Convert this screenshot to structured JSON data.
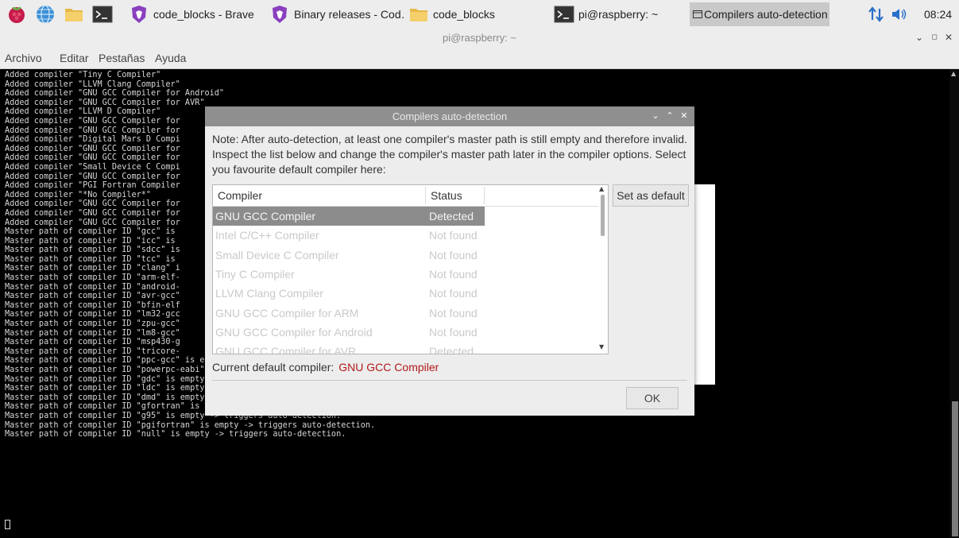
{
  "taskbar": {
    "launchers": [
      {
        "name": "raspberry-menu-icon"
      },
      {
        "name": "web-browser-icon"
      },
      {
        "name": "file-manager-icon"
      },
      {
        "name": "terminal-icon"
      }
    ],
    "windows": [
      {
        "label": "code_blocks - Brave",
        "icon": "brave-icon",
        "active": false
      },
      {
        "label": "Binary releases - Cod…",
        "icon": "brave-icon",
        "active": false
      },
      {
        "label": "code_blocks",
        "icon": "folder-icon",
        "active": false
      },
      {
        "label": "pi@raspberry: ~",
        "icon": "terminal-icon",
        "active": false
      },
      {
        "label": "Compilers auto-detection",
        "icon": "window-icon",
        "active": true
      }
    ],
    "clock": "08:24"
  },
  "window": {
    "title": "pi@raspberry: ~"
  },
  "menubar": {
    "items": [
      "Archivo",
      "Editar",
      "Pestañas",
      "Ayuda"
    ]
  },
  "terminal": {
    "lines": [
      "Added compiler \"Tiny C Compiler\"",
      "Added compiler \"LLVM Clang Compiler\"",
      "Added compiler \"GNU GCC Compiler for Android\"",
      "Added compiler \"GNU GCC Compiler for AVR\"",
      "Added compiler \"LLVM D Compiler\"",
      "Added compiler \"GNU GCC Compiler for",
      "Added compiler \"GNU GCC Compiler for",
      "Added compiler \"Digital Mars D Compi",
      "Added compiler \"GNU GCC Compiler for",
      "Added compiler \"GNU GCC Compiler for",
      "Added compiler \"Small Device C Compi",
      "Added compiler \"GNU GCC Compiler for",
      "Added compiler \"PGI Fortran Compiler",
      "Added compiler \"*No Compiler*\"",
      "Added compiler \"GNU GCC Compiler for",
      "Added compiler \"GNU GCC Compiler for",
      "Added compiler \"GNU GCC Compiler for",
      "Master path of compiler ID \"gcc\" is",
      "Master path of compiler ID \"icc\" is",
      "Master path of compiler ID \"sdcc\" is",
      "Master path of compiler ID \"tcc\" is",
      "Master path of compiler ID \"clang\" i",
      "Master path of compiler ID \"arm-elf-",
      "Master path of compiler ID \"android-",
      "Master path of compiler ID \"avr-gcc\"",
      "Master path of compiler ID \"bfin-elf",
      "Master path of compiler ID \"lm32-gcc",
      "Master path of compiler ID \"zpu-gcc\"",
      "Master path of compiler ID \"lm8-gcc\"",
      "Master path of compiler ID \"msp430-g",
      "Master path of compiler ID \"tricore-",
      "Master path of compiler ID \"ppc-gcc\" is empty -> triggers auto-detection.",
      "Master path of compiler ID \"powerpc-eabi\" is empty -> triggers auto-detection.",
      "Master path of compiler ID \"gdc\" is empty -> triggers auto-detection.",
      "Master path of compiler ID \"ldc\" is empty -> triggers auto-detection.",
      "Master path of compiler ID \"dmd\" is empty -> triggers auto-detection.",
      "Master path of compiler ID \"gfortran\" is empty -> triggers auto-detection.",
      "Master path of compiler ID \"g95\" is empty -> triggers auto-detection.",
      "Master path of compiler ID \"pgifortran\" is empty -> triggers auto-detection.",
      "Master path of compiler ID \"null\" is empty -> triggers auto-detection."
    ]
  },
  "dialog": {
    "title": "Compilers auto-detection",
    "note": "Note: After auto-detection, at least one compiler's master path is still empty and therefore invalid. Inspect the list below and change the compiler's master path later in the compiler options. Select you favourite default compiler here:",
    "columns": [
      "Compiler",
      "Status"
    ],
    "rows": [
      {
        "compiler": "GNU GCC Compiler",
        "status": "Detected",
        "selected": true
      },
      {
        "compiler": "Intel C/C++ Compiler",
        "status": "Not found",
        "selected": false
      },
      {
        "compiler": "Small Device C Compiler",
        "status": "Not found",
        "selected": false
      },
      {
        "compiler": "Tiny C Compiler",
        "status": "Not found",
        "selected": false
      },
      {
        "compiler": "LLVM Clang Compiler",
        "status": "Not found",
        "selected": false
      },
      {
        "compiler": "GNU GCC Compiler for ARM",
        "status": "Not found",
        "selected": false
      },
      {
        "compiler": "GNU GCC Compiler for Android",
        "status": "Not found",
        "selected": false
      },
      {
        "compiler": "GNU GCC Compiler for AVR",
        "status": "Detected",
        "selected": false
      }
    ],
    "set_default_label": "Set as default",
    "current_default_label": "Current default compiler:",
    "current_default_value": "GNU GCC Compiler",
    "ok_label": "OK"
  }
}
